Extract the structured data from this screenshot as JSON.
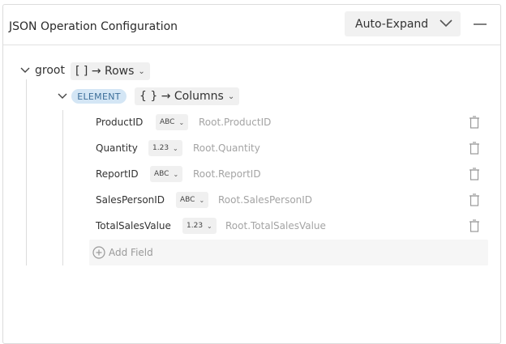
{
  "header": {
    "title": "JSON Operation Configuration",
    "expand_mode": "Auto-Expand"
  },
  "tree": {
    "root": {
      "name": "groot",
      "type_label": "[ ] → Rows",
      "element": {
        "badge": "ELEMENT",
        "type_label": "{ } → Columns",
        "fields": [
          {
            "name": "ProductID",
            "type": "ABC",
            "path": "Root.ProductID"
          },
          {
            "name": "Quantity",
            "type": "1.23",
            "path": "Root.Quantity"
          },
          {
            "name": "ReportID",
            "type": "ABC",
            "path": "Root.ReportID"
          },
          {
            "name": "SalesPersonID",
            "type": "ABC",
            "path": "Root.SalesPersonID"
          },
          {
            "name": "TotalSalesValue",
            "type": "1.23",
            "path": "Root.TotalSalesValue"
          }
        ],
        "add_field_label": "Add Field"
      }
    }
  },
  "icons": {
    "expand_dropdown": "chevron-down-icon",
    "collapse_panel": "minus-icon",
    "tree_toggle": "chevron-down-icon",
    "delete_field": "trash-icon",
    "add_field": "plus-circle-icon"
  }
}
